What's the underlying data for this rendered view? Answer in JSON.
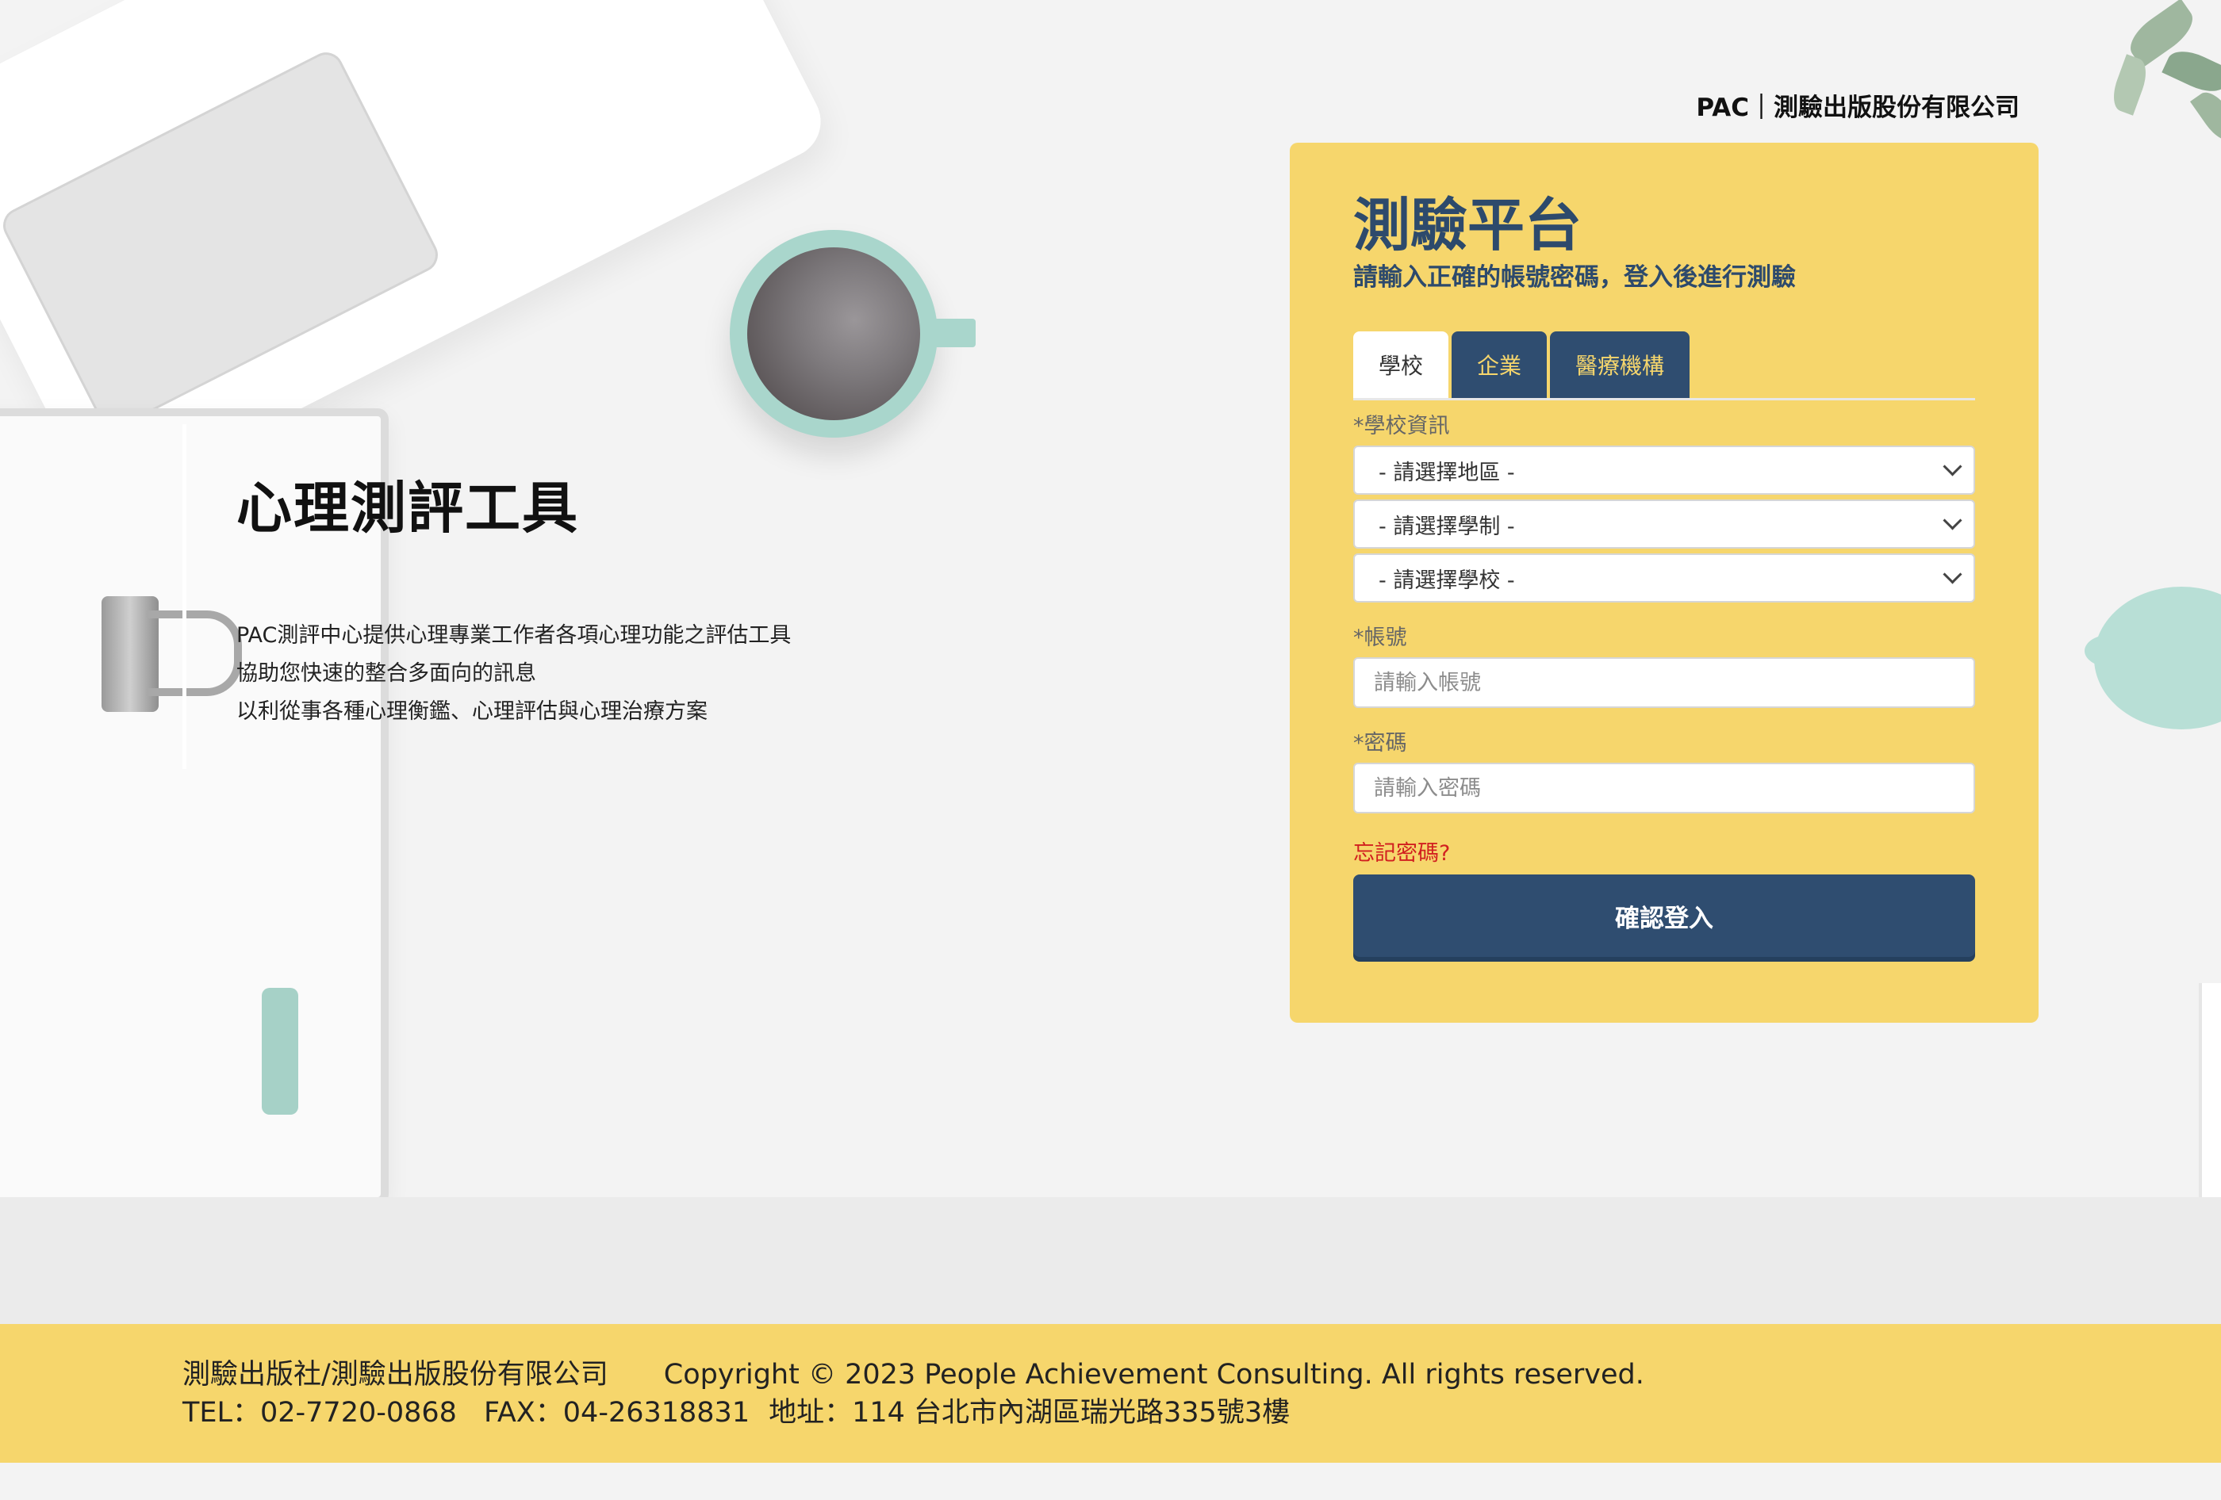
{
  "brand": {
    "text": "PAC｜測驗出版股份有限公司"
  },
  "intro": {
    "title": "心理測評工具",
    "lines": [
      "PAC測評中心提供心理專業工作者各項心理功能之評估工具",
      "協助您快速的整合多面向的訊息",
      "以利從事各種心理衡鑑、心理評估與心理治療方案"
    ]
  },
  "login": {
    "title": "測驗平台",
    "subtitle": "請輸入正確的帳號密碼，登入後進行測驗",
    "tabs": [
      {
        "label": "學校",
        "active": true
      },
      {
        "label": "企業",
        "active": false
      },
      {
        "label": "醫療機構",
        "active": false
      }
    ],
    "school_info_label": "*學校資訊",
    "selects": [
      {
        "value": "- 請選擇地區 -"
      },
      {
        "value": "- 請選擇學制 -"
      },
      {
        "value": "- 請選擇學校 -"
      }
    ],
    "account_label": "*帳號",
    "account_placeholder": "請輸入帳號",
    "account_value": "",
    "password_label": "*密碼",
    "password_placeholder": "請輸入密碼",
    "password_value": "",
    "forgot_label": "忘記密碼?",
    "submit_label": "確認登入"
  },
  "footer": {
    "company": "測驗出版社/測驗出版股份有限公司",
    "copyright": "Copyright © 2023 People Achievement Consulting. All rights reserved.",
    "tel": "TEL：02-7720-0868",
    "fax": "FAX：04-26318831",
    "address": "地址：114 台北市內湖區瑞光路335號3樓"
  },
  "colors": {
    "panel_bg": "#f6d66c",
    "accent_navy": "#2f4d70",
    "forgot_red": "#d11f1f",
    "page_bg": "#f3f3f3"
  }
}
